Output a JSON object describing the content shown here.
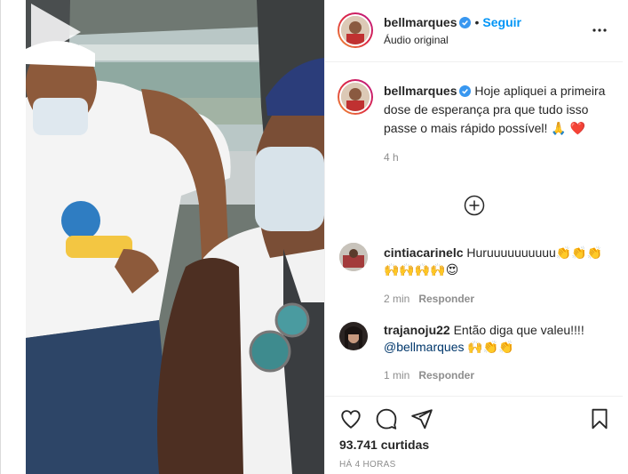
{
  "post": {
    "author": "bellmarques",
    "follow_label": "Seguir",
    "audio_label": "Áudio original",
    "caption_text": "Hoje apliquei a primeira dose de esperança pra que tudo isso passe o mais rápido possível! 🙏 ❤️",
    "caption_time": "4 h"
  },
  "comments": [
    {
      "username": "cintiacarinelc",
      "text": "Huruuuuuuuuuu👏👏👏 🙌🙌🙌🙌😍",
      "time": "2 min",
      "reply_label": "Responder"
    },
    {
      "username": "trajanoju22",
      "text": "Então diga que valeu!!!!",
      "mention": "@bellmarques",
      "emoji": "🙌👏👏",
      "time": "1 min",
      "reply_label": "Responder"
    }
  ],
  "footer": {
    "likes": "93.741 curtidas",
    "posted_ago": "HÁ 4 HORAS"
  },
  "icons": [
    "heart-icon",
    "comment-icon",
    "share-icon",
    "bookmark-icon",
    "more-options-icon",
    "plus-circle-icon",
    "play-icon",
    "verified-icon"
  ],
  "colors": {
    "follow": "#0095f6",
    "verified": "#3897f0",
    "meta": "#8e8e8e"
  }
}
